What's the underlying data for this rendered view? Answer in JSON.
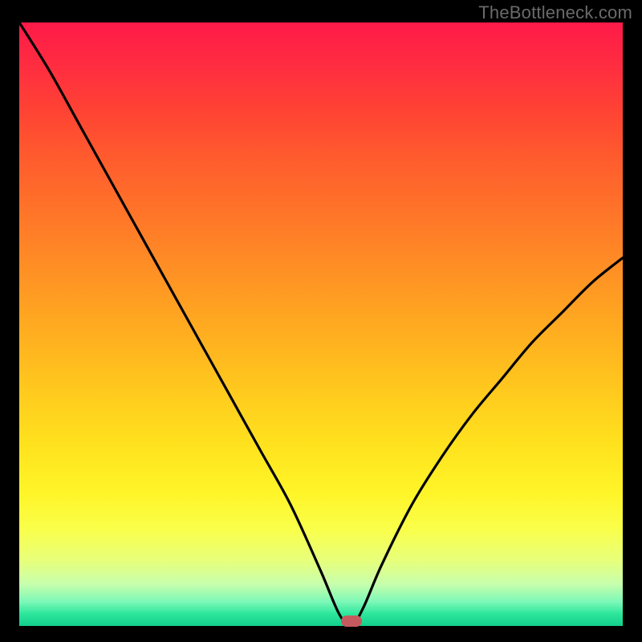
{
  "watermark": "TheBottleneck.com",
  "colors": {
    "frame": "#000000",
    "marker": "#c45a5d",
    "curve": "#000000"
  },
  "chart_data": {
    "type": "line",
    "title": "",
    "xlabel": "",
    "ylabel": "",
    "xlim": [
      0,
      100
    ],
    "ylim": [
      0,
      100
    ],
    "grid": false,
    "legend": false,
    "series": [
      {
        "name": "bottleneck-curve",
        "x": [
          0,
          5,
          10,
          15,
          20,
          25,
          30,
          35,
          40,
          45,
          50,
          53,
          55,
          57,
          60,
          65,
          70,
          75,
          80,
          85,
          90,
          95,
          100
        ],
        "values": [
          100,
          92,
          83,
          74,
          65,
          56,
          47,
          38,
          29,
          20,
          9,
          2,
          0,
          3,
          10,
          20,
          28,
          35,
          41,
          47,
          52,
          57,
          61
        ]
      }
    ],
    "marker": {
      "x": 55,
      "y": 0
    },
    "background_gradient": {
      "top": "#ff1a49",
      "bottom": "#12cf8d"
    }
  }
}
